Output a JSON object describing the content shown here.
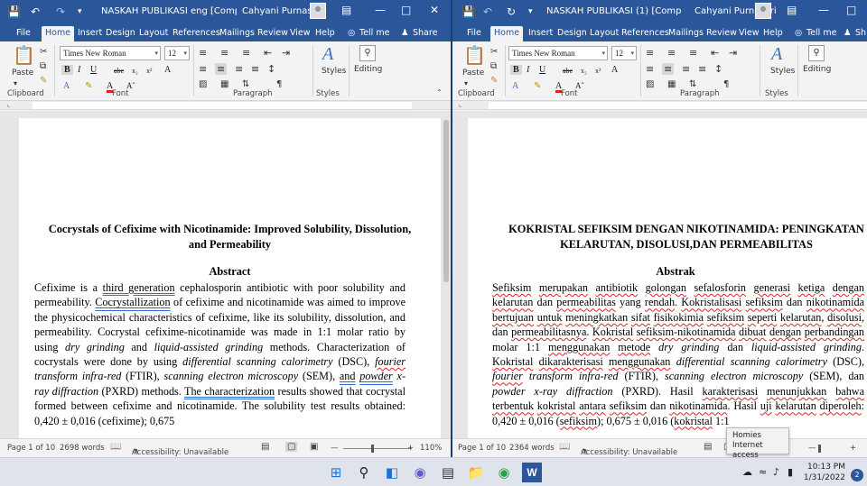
{
  "left": {
    "title": "NASKAH PUBLIKASI  eng [Compatib...",
    "user": "Cahyani Purnasari",
    "tabs": [
      "File",
      "Home",
      "Insert",
      "Design",
      "Layout",
      "References",
      "Mailings",
      "Review",
      "View",
      "Help",
      "Tell me",
      "Share"
    ],
    "ribbon": {
      "paste": "Paste",
      "font_name": "Times New Roman",
      "font_size": "12",
      "styles": "Styles",
      "editing": "Editing",
      "groups": [
        "Clipboard",
        "Font",
        "Paragraph",
        "Styles"
      ]
    },
    "doc": {
      "title_l1": "Cocrystals of Cefixime with Nicotinamide: Improved Solubility, Dissolution,",
      "title_l2": "and Permeability",
      "abstract_heading": "Abstract"
    },
    "status": {
      "page": "Page 1 of 10",
      "words": "2698 words",
      "accessibility": "Accessibility: Unavailable",
      "zoom": "110%"
    }
  },
  "right": {
    "title": "NASKAH PUBLIKASI (1) [Compatib...",
    "user": "Cahyani Purnasari",
    "tabs": [
      "File",
      "Home",
      "Insert",
      "Design",
      "Layout",
      "References",
      "Mailings",
      "Review",
      "View",
      "Help",
      "Tell me",
      "Sh"
    ],
    "ribbon": {
      "paste": "Paste",
      "font_name": "Times New Roman",
      "font_size": "12",
      "styles": "Styles",
      "editing": "Editing",
      "groups": [
        "Clipboard",
        "Font",
        "Paragraph",
        "Styles"
      ]
    },
    "doc": {
      "title_l1": "KOKRISTAL SEFIKSIM DENGAN NIKOTINAMIDA: PENINGKATAN",
      "title_l2": "KELARUTAN, DISOLUSI,DAN PERMEABILITAS",
      "abstract_heading": "Abstrak"
    },
    "status": {
      "page": "Page 1 of 10",
      "words": "2364 words",
      "accessibility": "Accessibility: Unavailable"
    }
  },
  "tooltip": {
    "line1": "Homies",
    "line2": "Internet access"
  },
  "clock": {
    "time": "10:13 PM",
    "date": "1/31/2022"
  },
  "notifications": "2",
  "colors": {
    "word_blue": "#2b579a",
    "taskbar": "#dfe4ec"
  }
}
